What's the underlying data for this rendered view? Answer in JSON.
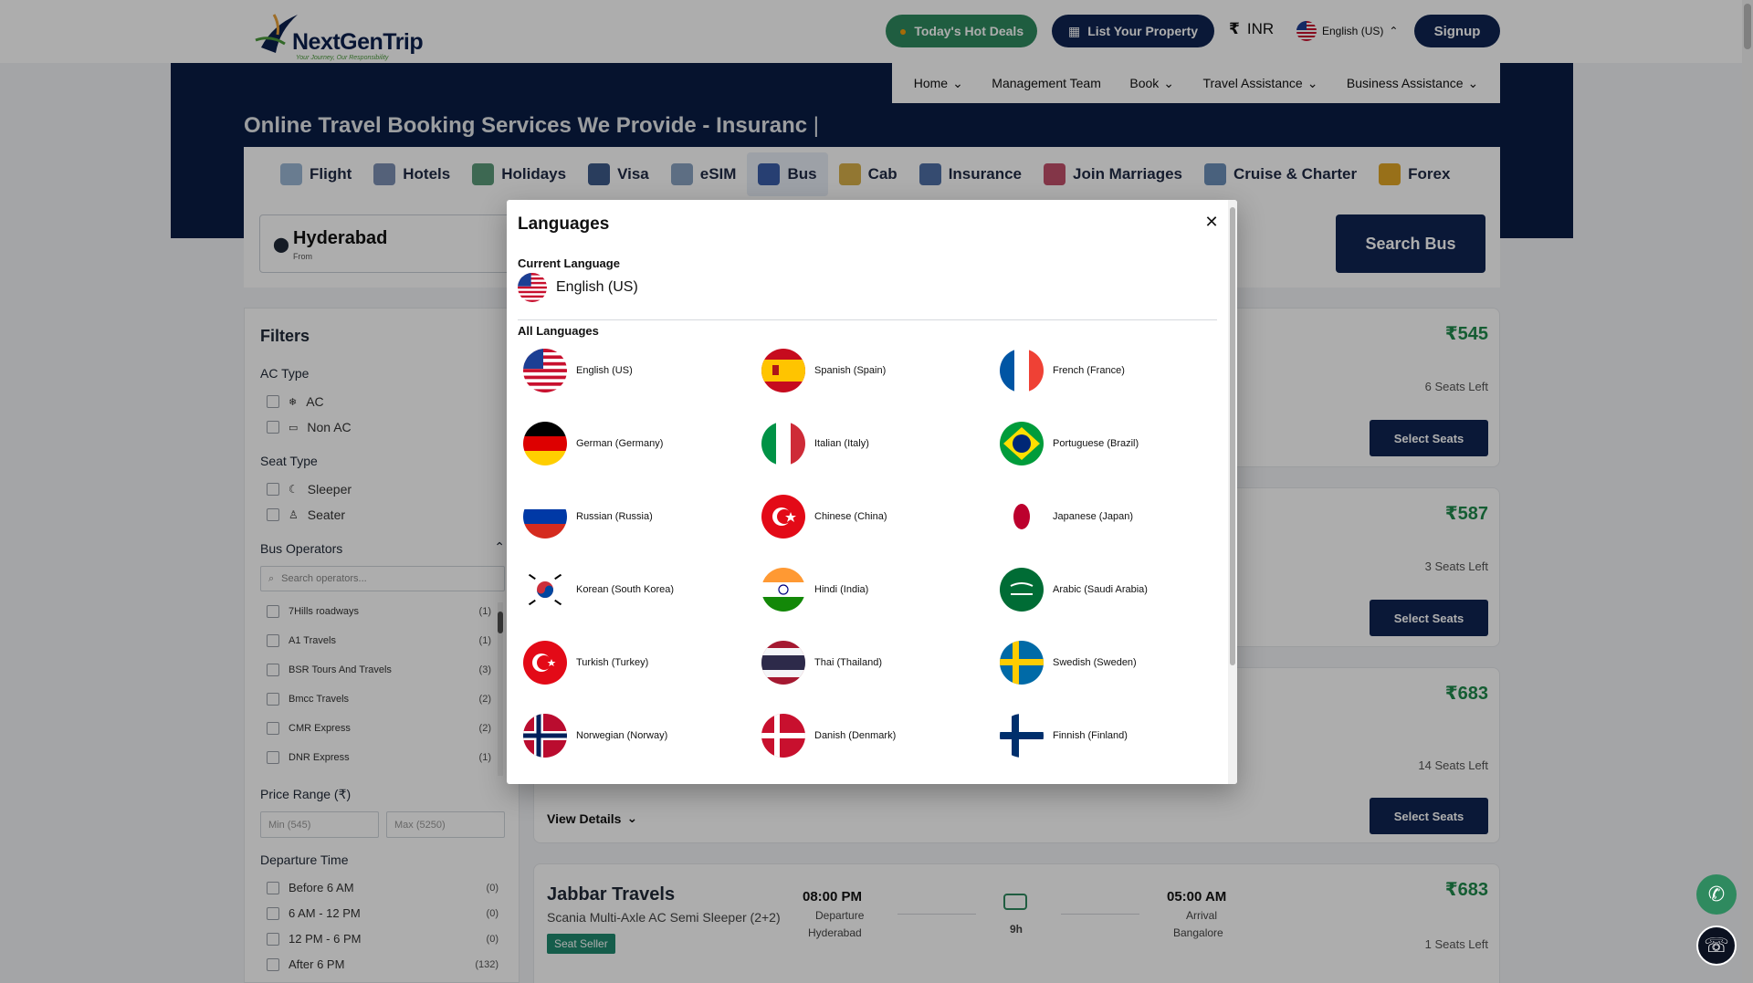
{
  "header": {
    "brand": "NextGenTrip",
    "tagline": "Your Journey, Our Responsibility",
    "deals_label": "Today's Hot Deals",
    "list_property_label": "List Your Property",
    "currency": "INR",
    "language": "English (US)",
    "signup_label": "Signup"
  },
  "nav": {
    "items": [
      "Home",
      "Management Team",
      "Book",
      "Travel Assistance",
      "Business Assistance"
    ]
  },
  "hero": {
    "title": "Online Travel Booking Services We Provide - Insuranc"
  },
  "tabs": [
    "Flight",
    "Hotels",
    "Holidays",
    "Visa",
    "eSIM",
    "Bus",
    "Cab",
    "Insurance",
    "Join Marriages",
    "Cruise & Charter",
    "Forex"
  ],
  "search": {
    "from_city": "Hyderabad",
    "from_label": "From",
    "button": "Search Bus"
  },
  "filters": {
    "title": "Filters",
    "ac_type": "AC Type",
    "ac": "AC",
    "non_ac": "Non AC",
    "seat_type": "Seat Type",
    "sleeper": "Sleeper",
    "seater": "Seater",
    "bus_operators": "Bus Operators",
    "operators_placeholder": "Search operators...",
    "operators": [
      {
        "name": "7Hills roadways",
        "count": "(1)"
      },
      {
        "name": "A1 Travels",
        "count": "(1)"
      },
      {
        "name": "BSR Tours And Travels",
        "count": "(3)"
      },
      {
        "name": "Bmcc Travels",
        "count": "(2)"
      },
      {
        "name": "CMR Express",
        "count": "(2)"
      },
      {
        "name": "DNR Express",
        "count": "(1)"
      }
    ],
    "price_range": "Price Range (₹)",
    "min_placeholder": "Min (545)",
    "max_placeholder": "Max (5250)",
    "departure_time": "Departure Time",
    "departure": [
      {
        "label": "Before 6 AM",
        "count": "(0)"
      },
      {
        "label": "6 AM - 12 PM",
        "count": "(0)"
      },
      {
        "label": "12 PM - 6 PM",
        "count": "(0)"
      },
      {
        "label": "After 6 PM",
        "count": "(132)"
      }
    ]
  },
  "results": {
    "cards": [
      {
        "price": "₹545",
        "seats": "6 Seats Left",
        "button": "Select Seats"
      },
      {
        "price": "₹587",
        "seats": "3 Seats Left",
        "button": "Select Seats"
      },
      {
        "price": "₹683",
        "seats": "14 Seats Left",
        "button": "Select Seats",
        "view_details": "View Details"
      },
      {
        "operator": "Jabbar Travels",
        "bus_type": "Scania Multi-Axle AC Semi Sleeper (2+2)",
        "badge": "Seat Seller",
        "departure_time": "08:00 PM",
        "departure_label": "Departure",
        "departure_city": "Hyderabad",
        "duration": "9h",
        "arrival_time": "05:00 AM",
        "arrival_label": "Arrival",
        "arrival_city": "Bangalore",
        "price": "₹683",
        "seats": "1 Seats Left"
      }
    ]
  },
  "modal": {
    "title": "Languages",
    "current_label": "Current Language",
    "current": "English (US)",
    "all_label": "All Languages",
    "languages": [
      "English (US)",
      "Spanish (Spain)",
      "French (France)",
      "German (Germany)",
      "Italian (Italy)",
      "Portuguese (Brazil)",
      "Russian (Russia)",
      "Chinese (China)",
      "Japanese (Japan)",
      "Korean (South Korea)",
      "Hindi (India)",
      "Arabic (Saudi Arabia)",
      "Turkish (Turkey)",
      "Thai (Thailand)",
      "Swedish (Sweden)",
      "Norwegian (Norway)",
      "Danish (Denmark)",
      "Finnish (Finland)"
    ]
  },
  "colors": {
    "navy": "#0f2451",
    "green": "#2f8a5f",
    "price_green": "#1f8a4c"
  }
}
